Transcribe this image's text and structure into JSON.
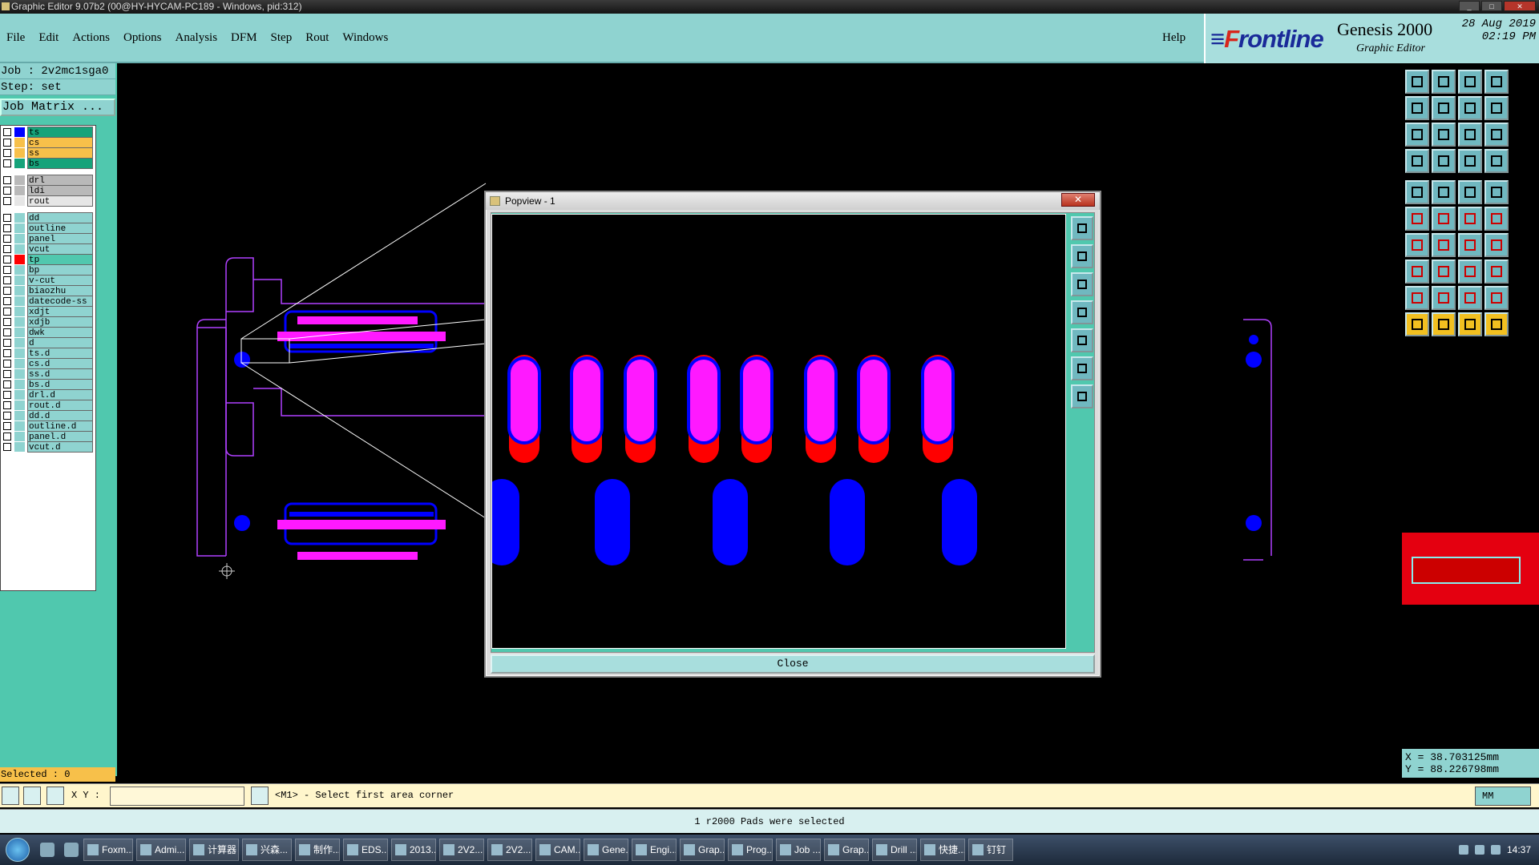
{
  "window": {
    "title": "Graphic Editor 9.07b2 (00@HY-HYCAM-PC189 - Windows, pid:312)"
  },
  "menu": {
    "items": [
      "File",
      "Edit",
      "Actions",
      "Options",
      "Analysis",
      "DFM",
      "Step",
      "Rout",
      "Windows"
    ],
    "help": "Help"
  },
  "brand": {
    "logo_prefix": "F",
    "logo_rest": "rontline",
    "product": "Genesis 2000",
    "subtitle": "Graphic Editor",
    "date": "28 Aug 2019",
    "time": "02:19 PM"
  },
  "job": {
    "job_line": "Job : 2v2mc1sga0",
    "step_line": "Step: set",
    "matrix_button": "Job Matrix ..."
  },
  "layers": [
    {
      "name": "ts",
      "color": "#16a37a",
      "swatch": "#0000ff"
    },
    {
      "name": "cs",
      "color": "#f7c04a",
      "swatch": "#f7c04a"
    },
    {
      "name": "ss",
      "color": "#f7c04a",
      "swatch": "#f7c04a"
    },
    {
      "name": "bs",
      "color": "#16a37a",
      "swatch": "#16a37a"
    },
    {
      "name": "drl",
      "color": "#b9b9b9",
      "swatch": "#b9b9b9"
    },
    {
      "name": "ldi",
      "color": "#b9b9b9",
      "swatch": "#b9b9b9"
    },
    {
      "name": "rout",
      "color": "#e6e6e6",
      "swatch": "#e6e6e6"
    },
    {
      "name": "dd",
      "color": "#8fd3d0",
      "swatch": "#8fd3d0"
    },
    {
      "name": "outline",
      "color": "#8fd3d0",
      "swatch": "#8fd3d0"
    },
    {
      "name": "panel",
      "color": "#8fd3d0",
      "swatch": "#8fd3d0"
    },
    {
      "name": "vcut",
      "color": "#8fd3d0",
      "swatch": "#8fd3d0"
    },
    {
      "name": "tp",
      "color": "#50c8ae",
      "swatch": "#ff0000"
    },
    {
      "name": "bp",
      "color": "#8fd3d0",
      "swatch": "#8fd3d0"
    },
    {
      "name": "v-cut",
      "color": "#8fd3d0",
      "swatch": "#8fd3d0"
    },
    {
      "name": "biaozhu",
      "color": "#8fd3d0",
      "swatch": "#8fd3d0"
    },
    {
      "name": "datecode-ss",
      "color": "#8fd3d0",
      "swatch": "#8fd3d0"
    },
    {
      "name": "xdjt",
      "color": "#8fd3d0",
      "swatch": "#8fd3d0"
    },
    {
      "name": "xdjb",
      "color": "#8fd3d0",
      "swatch": "#8fd3d0"
    },
    {
      "name": "dwk",
      "color": "#8fd3d0",
      "swatch": "#8fd3d0"
    },
    {
      "name": "d",
      "color": "#8fd3d0",
      "swatch": "#8fd3d0"
    },
    {
      "name": "ts.d",
      "color": "#8fd3d0",
      "swatch": "#8fd3d0"
    },
    {
      "name": "cs.d",
      "color": "#8fd3d0",
      "swatch": "#8fd3d0"
    },
    {
      "name": "ss.d",
      "color": "#8fd3d0",
      "swatch": "#8fd3d0"
    },
    {
      "name": "bs.d",
      "color": "#8fd3d0",
      "swatch": "#8fd3d0"
    },
    {
      "name": "drl.d",
      "color": "#8fd3d0",
      "swatch": "#8fd3d0"
    },
    {
      "name": "rout.d",
      "color": "#8fd3d0",
      "swatch": "#8fd3d0"
    },
    {
      "name": "dd.d",
      "color": "#8fd3d0",
      "swatch": "#8fd3d0"
    },
    {
      "name": "outline.d",
      "color": "#8fd3d0",
      "swatch": "#8fd3d0"
    },
    {
      "name": "panel.d",
      "color": "#8fd3d0",
      "swatch": "#8fd3d0"
    },
    {
      "name": "vcut.d",
      "color": "#8fd3d0",
      "swatch": "#8fd3d0"
    }
  ],
  "selected": "Selected : 0",
  "popview": {
    "title": "Popview - 1",
    "close_label": "Close"
  },
  "coords": {
    "x": "X = 38.703125mm",
    "y": "Y = 88.226798mm"
  },
  "status": {
    "xy_label": "X Y :",
    "xy_value": "",
    "prompt": "<M1> - Select first area corner",
    "unit": "MM"
  },
  "message": "1 r2000 Pads were selected",
  "taskbar": {
    "tasks": [
      "Foxm...",
      "Admi...",
      "计算器",
      "兴森...",
      "制作...",
      "EDS...",
      "2013...",
      "2V2...",
      "2V2...",
      "CAM...",
      "Gene...",
      "Engi...",
      "Grap...",
      "Prog...",
      "Job ...",
      "Grap...",
      "Drill ...",
      "快捷...",
      "钉钉"
    ],
    "clock": "14:37"
  },
  "colors": {
    "panel": "#50c8ae",
    "menu": "#8fd3d0",
    "pad_top": "#ff19ff",
    "pad_bottom": "#ff0000",
    "pad_blue": "#0000ff",
    "outline": "#b040ff"
  }
}
